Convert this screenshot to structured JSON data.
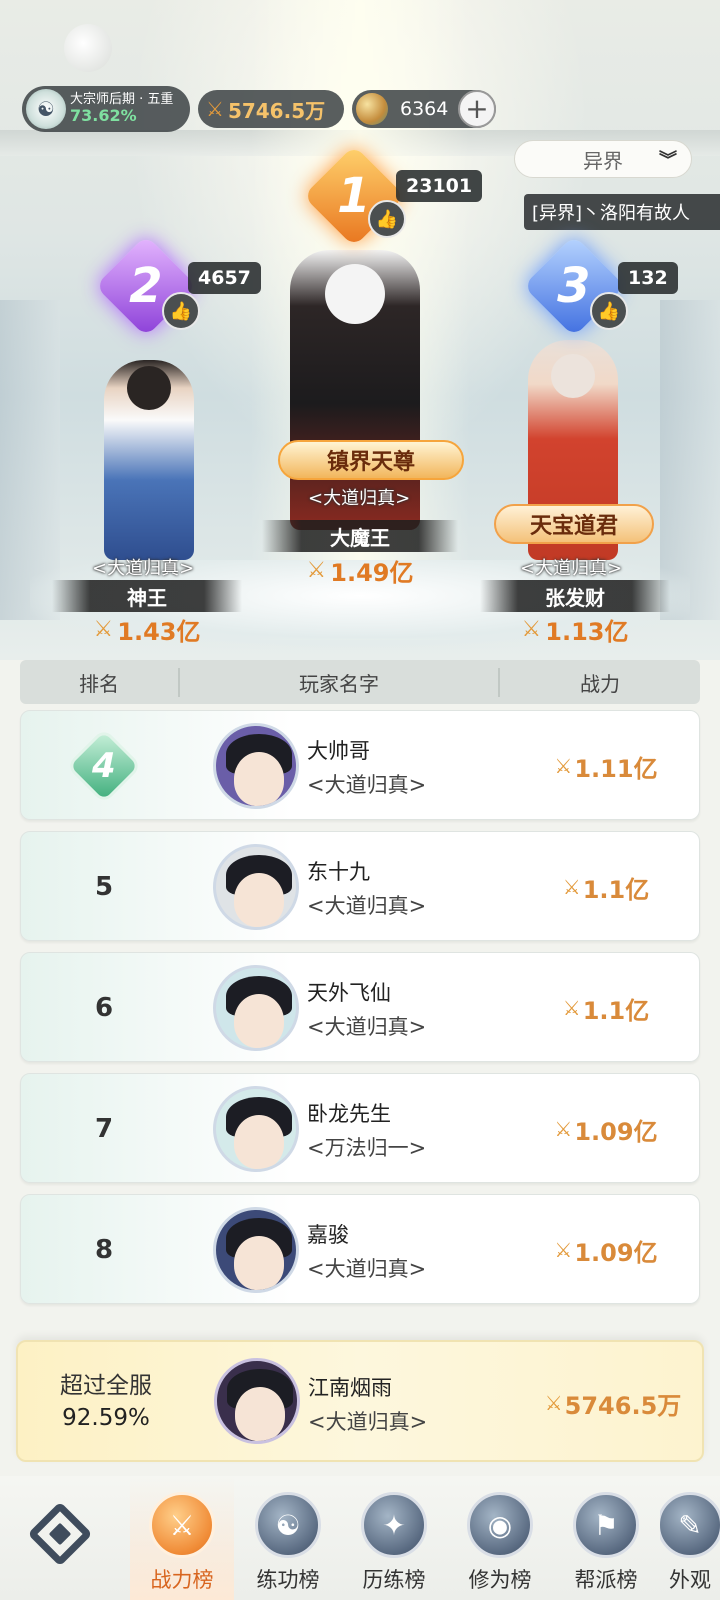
{
  "status": {
    "realm_name": "大宗师后期 · 五重",
    "realm_progress": "73.62%",
    "power": "5746.5万",
    "coins": "6364",
    "plus_label": "+"
  },
  "world_select": {
    "value": "异界"
  },
  "ticker": {
    "text": "[异界]丶洛阳有故人"
  },
  "top3": [
    {
      "rank": "1",
      "likes": "23101",
      "title": "镇界天尊",
      "guild": "<大道归真>",
      "name": "大魔王",
      "power": "1.49亿"
    },
    {
      "rank": "2",
      "likes": "4657",
      "title": "",
      "guild": "<大道归真>",
      "name": "神王",
      "power": "1.43亿"
    },
    {
      "rank": "3",
      "likes": "132",
      "title": "天宝道君",
      "guild": "<大道归真>",
      "name": "张发财",
      "power": "1.13亿"
    }
  ],
  "table": {
    "headers": {
      "rank": "排名",
      "name": "玩家名字",
      "power": "战力"
    },
    "rows": [
      {
        "rank": "4",
        "name": "大帅哥",
        "guild": "<大道归真>",
        "power": "1.11亿"
      },
      {
        "rank": "5",
        "name": "东十九",
        "guild": "<大道归真>",
        "power": "1.1亿"
      },
      {
        "rank": "6",
        "name": "天外飞仙",
        "guild": "<大道归真>",
        "power": "1.1亿"
      },
      {
        "rank": "7",
        "name": "卧龙先生",
        "guild": "<万法归一>",
        "power": "1.09亿"
      },
      {
        "rank": "8",
        "name": "嘉骏",
        "guild": "<大道归真>",
        "power": "1.09亿"
      }
    ]
  },
  "me": {
    "exceed_label": "超过全服",
    "exceed_pct": "92.59%",
    "name": "江南烟雨",
    "guild": "<大道归真>",
    "power": "5746.5万"
  },
  "nav": [
    {
      "label": "战力榜",
      "icon": "crossed-swords-icon",
      "active": true
    },
    {
      "label": "练功榜",
      "icon": "yin-yang-icon",
      "active": false
    },
    {
      "label": "历练榜",
      "icon": "star-planet-icon",
      "active": false
    },
    {
      "label": "修为榜",
      "icon": "meditation-icon",
      "active": false
    },
    {
      "label": "帮派榜",
      "icon": "banner-icon",
      "active": false
    },
    {
      "label": "外观",
      "icon": "fan-icon",
      "active": false
    }
  ],
  "colors": {
    "accent_orange": "#e07a24",
    "rank1": "#e8741e",
    "rank2": "#8b3ed8",
    "rank3": "#3f6ee0",
    "rank4_green": "#3fae7c"
  }
}
